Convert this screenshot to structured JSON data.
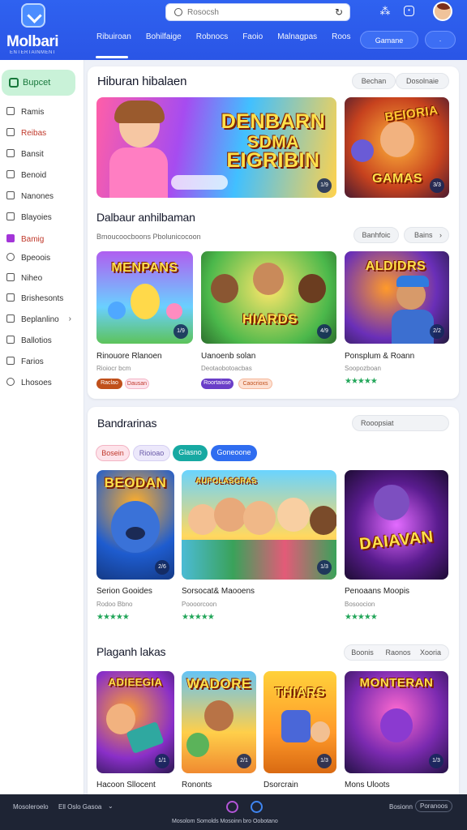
{
  "header": {
    "logo_text": "Molbari",
    "logo_subtext": "ENTERTAINMENT",
    "search_placeholder": "Rosocsh",
    "nav": [
      "Ribuiroan",
      "Bohilfaige",
      "Robnocs",
      "Faoio",
      "Malnagpas",
      "Roos"
    ],
    "btn_primary": "Gamane",
    "btn_secondary": "·",
    "icons": [
      "apps-icon",
      "notification-icon"
    ]
  },
  "sidebar": {
    "active": "Bupcet",
    "items": [
      "Ramis",
      "Reibas",
      "Bansit",
      "Benoid",
      "Nanones",
      "Blayoies",
      "Bamig",
      "Bpeoois",
      "Niheo",
      "Brishesonts",
      "Beplanlino",
      "Ballotios",
      "Farios",
      "Lhosoes"
    ]
  },
  "section1": {
    "title": "Hiburan hibalaen",
    "pills": [
      "Bechan",
      "Dosolnaie"
    ],
    "hero_text_1": "DENBARN",
    "hero_text_2": "SDMA",
    "hero_text_3": "EIGRIBIN",
    "hero_badge": "1/9",
    "side_text_1": "BEIORIA",
    "side_text_2": "GAMAS",
    "side_badge": "3/3",
    "title2": "Dalbaur anhilbaman",
    "subtitle2": "Bmoucoocboons Pbolunicocoon",
    "pills2": [
      "Banhfoic",
      "Bains"
    ],
    "games": [
      {
        "art": "MENPANS",
        "badge": "1/9",
        "title": "Rinouore Rlanoen",
        "sub": "Rioiocr bcm",
        "tags": [
          "Raclao",
          "Dausan"
        ]
      },
      {
        "art": "HIARDS",
        "badge": "4/9",
        "title": "Uanoenb solan",
        "sub": "Deotaobotoacbas",
        "tags": [
          "Roortaiose",
          "Caocrioxs"
        ]
      },
      {
        "art": "ALDIDRS",
        "badge": "2/2",
        "title": "Ponsplum & Roann",
        "sub": "Soopozboan",
        "stars": "★★★★★"
      }
    ]
  },
  "section2": {
    "title": "Bandrarinas",
    "pill": "Rooopsiat",
    "chips": [
      "Bosein",
      "Rioioao",
      "Glasno",
      "Goneoone"
    ],
    "games": [
      {
        "art": "BEODAN",
        "badge": "2/6",
        "title": "Serion Gooides",
        "sub": "Rodoo Bbno",
        "stars": "★★★★★"
      },
      {
        "art": "AUPOLASGRAS",
        "badge": "1/3",
        "title": "Sorsocat& Maooens",
        "sub": "Poooorcoon",
        "stars": "★★★★★"
      },
      {
        "art": "DAIAVAN",
        "badge": "",
        "title": "Penoaans Moopis",
        "sub": "Bosoocion",
        "stars": "★★★★★"
      }
    ],
    "title2": "Plaganh lakas",
    "pills2": [
      "Boonis",
      "Raonos",
      "Xooria"
    ],
    "games2": [
      {
        "art": "ADIEEGIA",
        "badge": "1/1",
        "title": "Hacoon Sllocent"
      },
      {
        "art": "WADORE",
        "badge": "2/1",
        "title": "Rononts"
      },
      {
        "art": "THIARS",
        "badge": "1/3",
        "title": "Dsorcrain"
      },
      {
        "art": "MONTERAN",
        "badge": "1/3",
        "title": "Mons Uloots"
      }
    ]
  },
  "footer": {
    "left_1": "Mosoleroelo",
    "left_2": "Ell Oslo Gasoa",
    "bottom": "Mosolom Somolds Mosoinn bro Oobotano",
    "right_1": "Bosionn",
    "right_2": "Poranoos"
  }
}
